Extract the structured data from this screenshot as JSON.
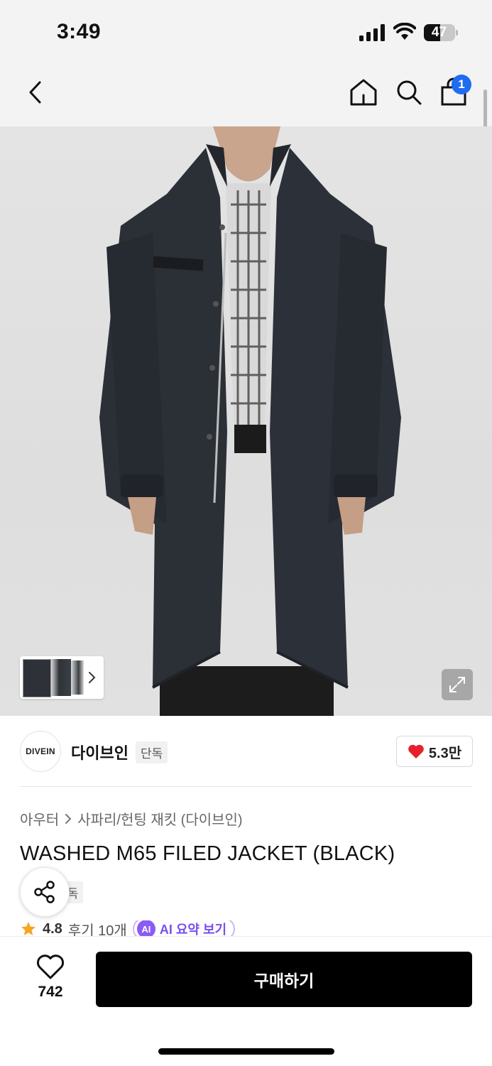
{
  "status_bar": {
    "time": "3:49",
    "battery": "47"
  },
  "nav": {
    "cart_count": "1",
    "icons": [
      "back-icon",
      "home-icon",
      "search-icon",
      "cart-icon"
    ]
  },
  "hero": {
    "icons": [
      "chevron-right-icon",
      "expand-icon"
    ]
  },
  "brand": {
    "logo_text": "DIVEIN",
    "name": "다이브인",
    "tag": "단독",
    "likes": "5.3만"
  },
  "breadcrumb": {
    "category": "아우터",
    "subcategory": "사파리/헌팅 재킷 (다이브인)"
  },
  "product": {
    "title": "WASHED M65 FILED JACKET (BLACK)",
    "tag": "단독",
    "rating": "4.8",
    "reviews": "후기 10개",
    "ai_badge": "AI",
    "ai_summary": "AI 요약 보기"
  },
  "bottom": {
    "wish_count": "742",
    "buy_label": "구매하기"
  },
  "colors": {
    "accent_blue": "#1e6cf0",
    "heart_red": "#e8202b",
    "ai_purple": "#7a4ef0",
    "star": "#f5a623"
  }
}
